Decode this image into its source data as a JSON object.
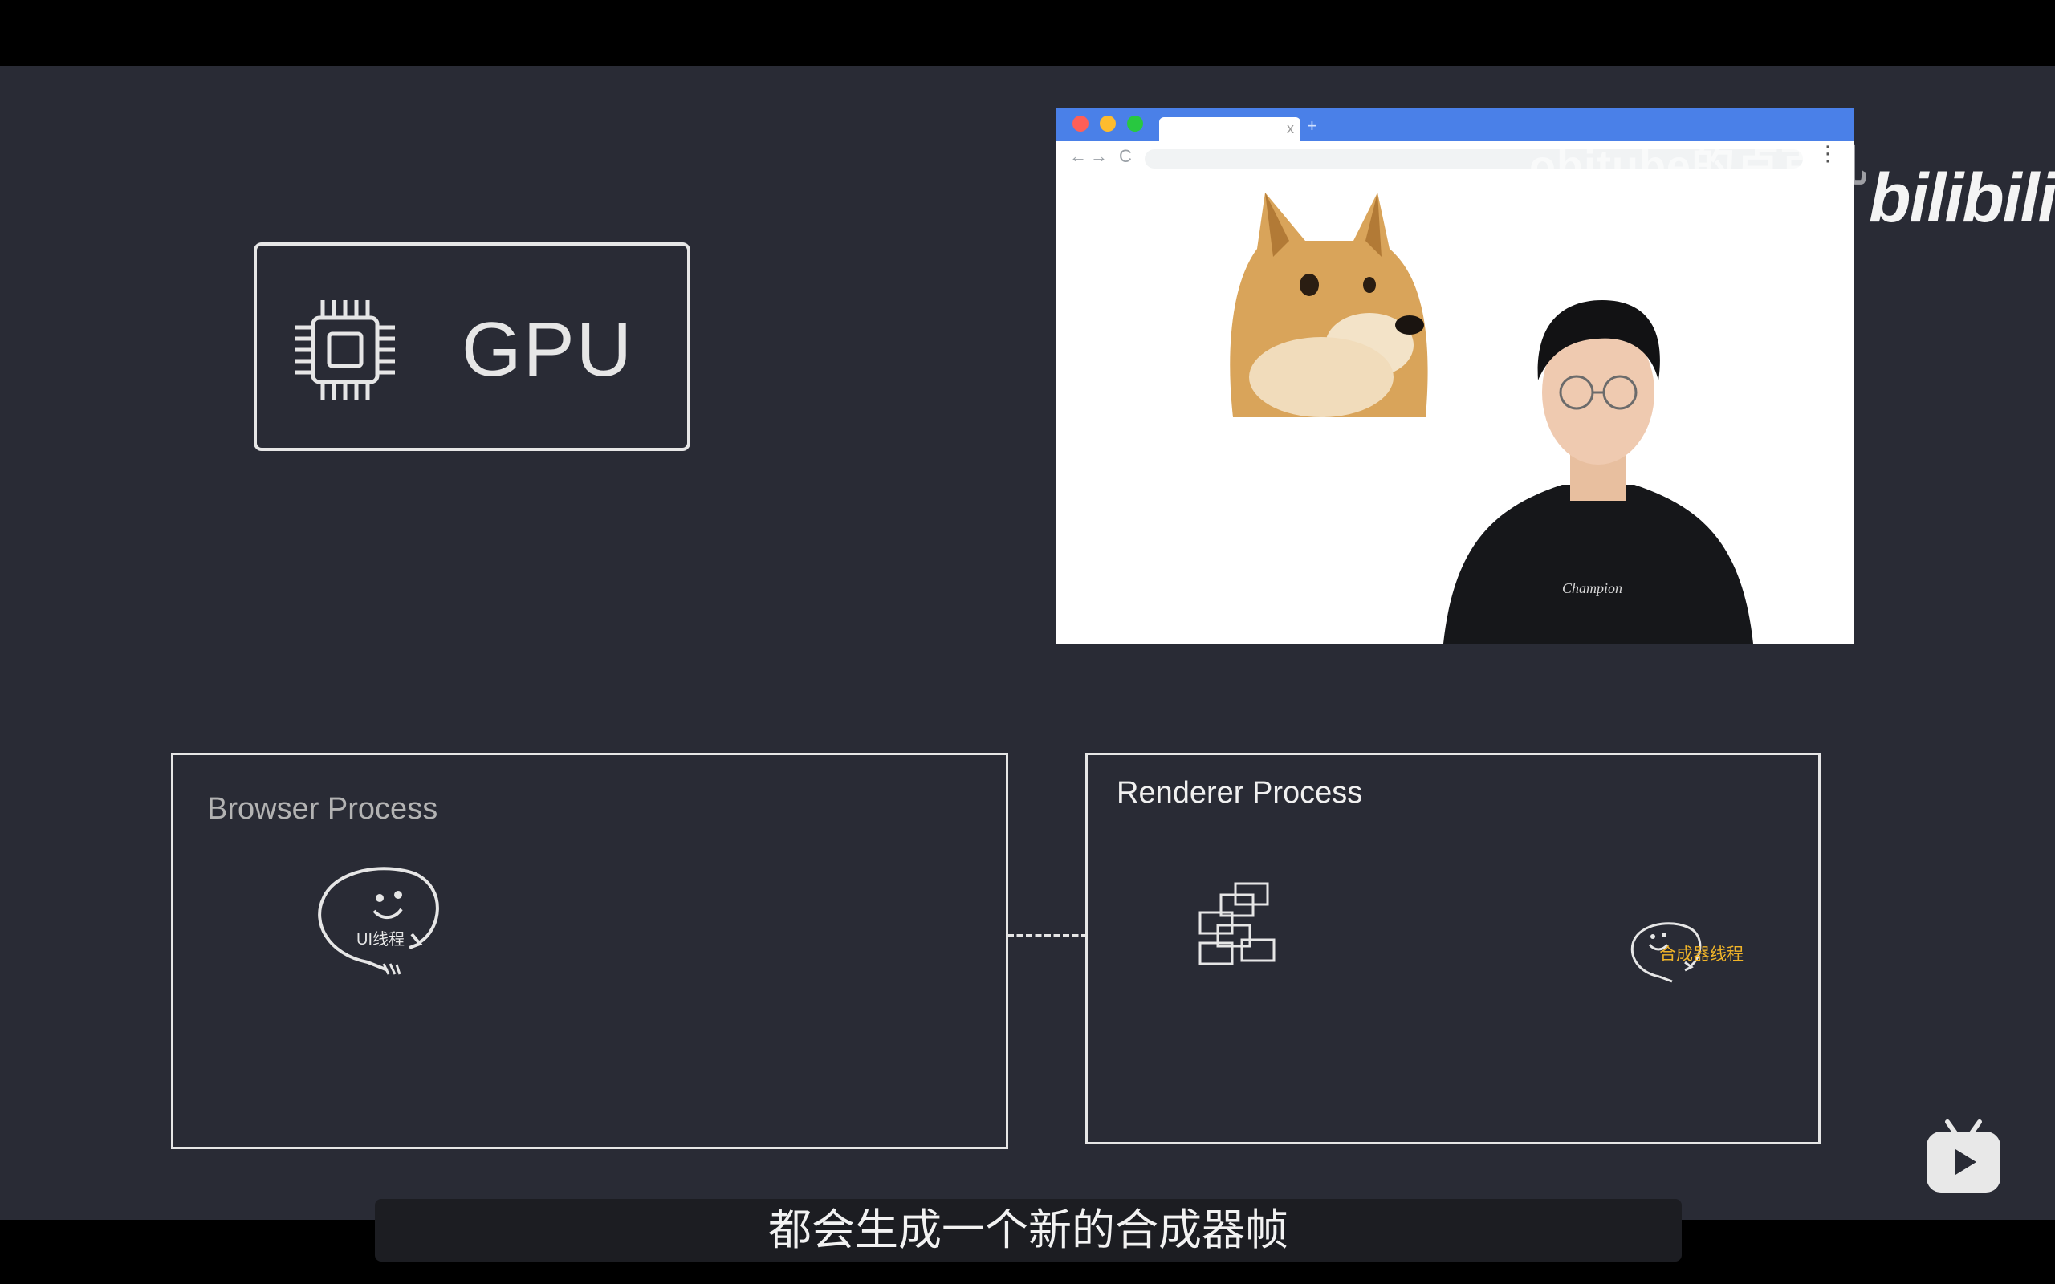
{
  "gpu": {
    "label": "GPU",
    "icon": "chip-icon"
  },
  "browser": {
    "traffic_lights": [
      "#ff5f57",
      "#febc2e",
      "#28c840"
    ],
    "tab_close": "x",
    "tab_new": "+",
    "nav_back": "←",
    "nav_forward": "→",
    "nav_reload": "C",
    "menu": "⋮"
  },
  "watermark": "objtube的卢克儿",
  "brand_logo": "bilibili",
  "browser_process": {
    "title": "Browser Process",
    "thread_label": "UI线程"
  },
  "renderer_process": {
    "title": "Renderer Process",
    "thread_label": "合成器线程"
  },
  "subtitle": "都会生成一个新的合成器帧",
  "colors": {
    "background": "#292b35",
    "browser_titlebar": "#4a80e8",
    "compositor_label": "#f0b429"
  }
}
